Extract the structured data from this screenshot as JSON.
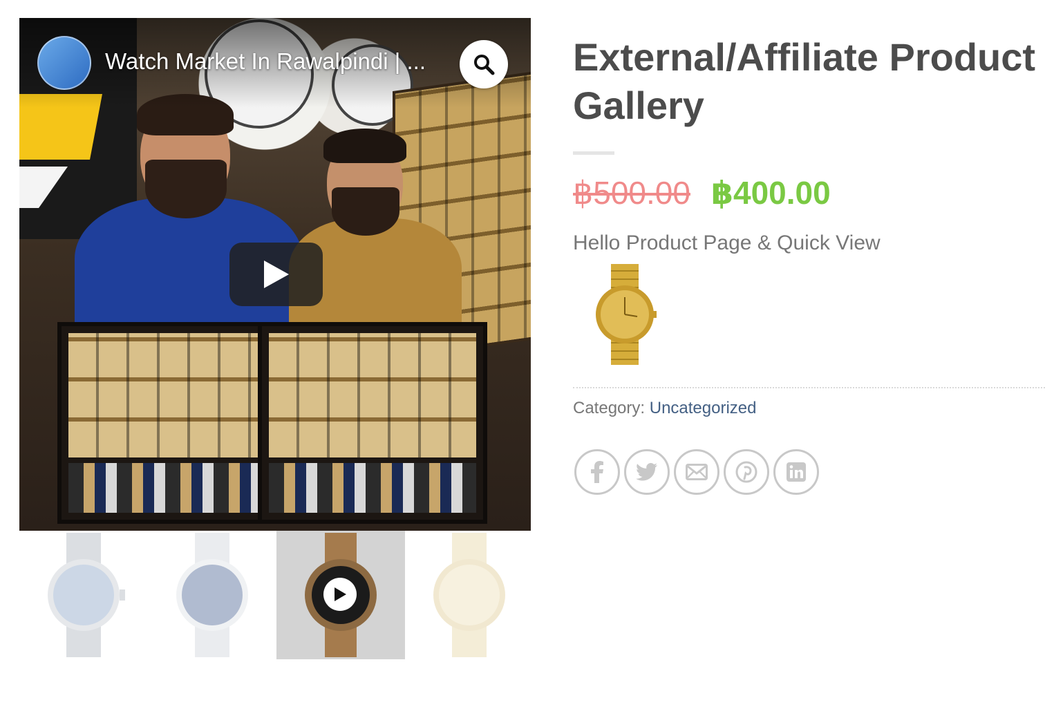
{
  "video": {
    "title": "Watch Market In Rawalpindi | ...",
    "channel_avatar": "channel-avatar",
    "zoom_icon": "magnifier-icon",
    "play_icon": "play-icon"
  },
  "thumbnails": [
    {
      "name": "silver-chronograph-watch",
      "active": false
    },
    {
      "name": "blue-dial-steel-watch",
      "active": false
    },
    {
      "name": "bronze-smartwatch-video",
      "active": true,
      "has_play": true
    },
    {
      "name": "gold-minimal-watch",
      "active": false
    }
  ],
  "product": {
    "title": "External/Affiliate Product Gallery",
    "price_old": "฿500.00",
    "price_new": "฿400.00",
    "short_description": "Hello Product Page & Quick View",
    "category_label": "Category:",
    "category_value": "Uncategorized"
  },
  "share": {
    "icons": [
      "facebook-icon",
      "twitter-icon",
      "email-icon",
      "pinterest-icon",
      "linkedin-icon"
    ]
  },
  "colors": {
    "title": "#4c4c4c",
    "price_old": "#f08a8a",
    "price_new": "#7ac943",
    "link": "#446084",
    "share_border": "#c8c8c8"
  }
}
